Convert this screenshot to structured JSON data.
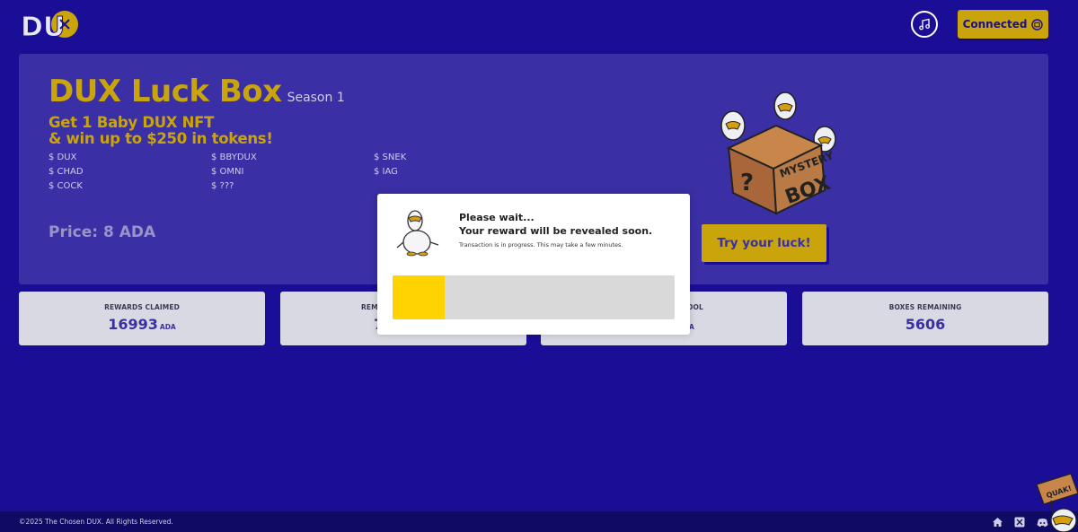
{
  "header": {
    "logo_icon": "dux-logo-icon",
    "music_icon": "music-note-icon",
    "connect_label": "Connected",
    "wallet_icon": "wallet-icon"
  },
  "panel": {
    "title": "DUX Luck Box",
    "season": "Season 1",
    "subtitle_line1": "Get 1 Baby DUX NFT",
    "subtitle_line2": "& win up to $250 in tokens!",
    "tokens": [
      "$ DUX",
      "$ BBYDUX",
      "$ SNEK",
      "$ CHAD",
      "$ OMNI",
      "$ IAG",
      "$ COCK",
      "$ ???"
    ],
    "price": "Price: 8 ADA",
    "luck_button": "Try your luck!",
    "mystery_box_icon": "mystery-box-icon"
  },
  "stats": [
    {
      "label": "REWARDS CLAIMED",
      "value": "16993",
      "unit": "ADA"
    },
    {
      "label": "REM",
      "value": "7",
      "unit": ""
    },
    {
      "label": "OOL",
      "value": "",
      "unit": "A"
    },
    {
      "label": "BOXES REMAINING",
      "value": "5606",
      "unit": ""
    }
  ],
  "modal": {
    "heading": "Please wait...",
    "subheading": "Your reward will be revealed soon.",
    "note": "Transaction is in progress. This may take a few minutes.",
    "duck_icon": "duck-icon",
    "progress": 0.185
  },
  "footer": {
    "copyright": "©2025 The Chosen DUX. All Rights Reserved.",
    "icons": [
      "home-icon",
      "x-icon",
      "discord-icon"
    ],
    "mascot_text": "QUAK!"
  },
  "colors": {
    "background": "#1a0d96",
    "panel": "#3b2fa5",
    "accent": "#c9a50b",
    "progress": "#ffd300"
  }
}
